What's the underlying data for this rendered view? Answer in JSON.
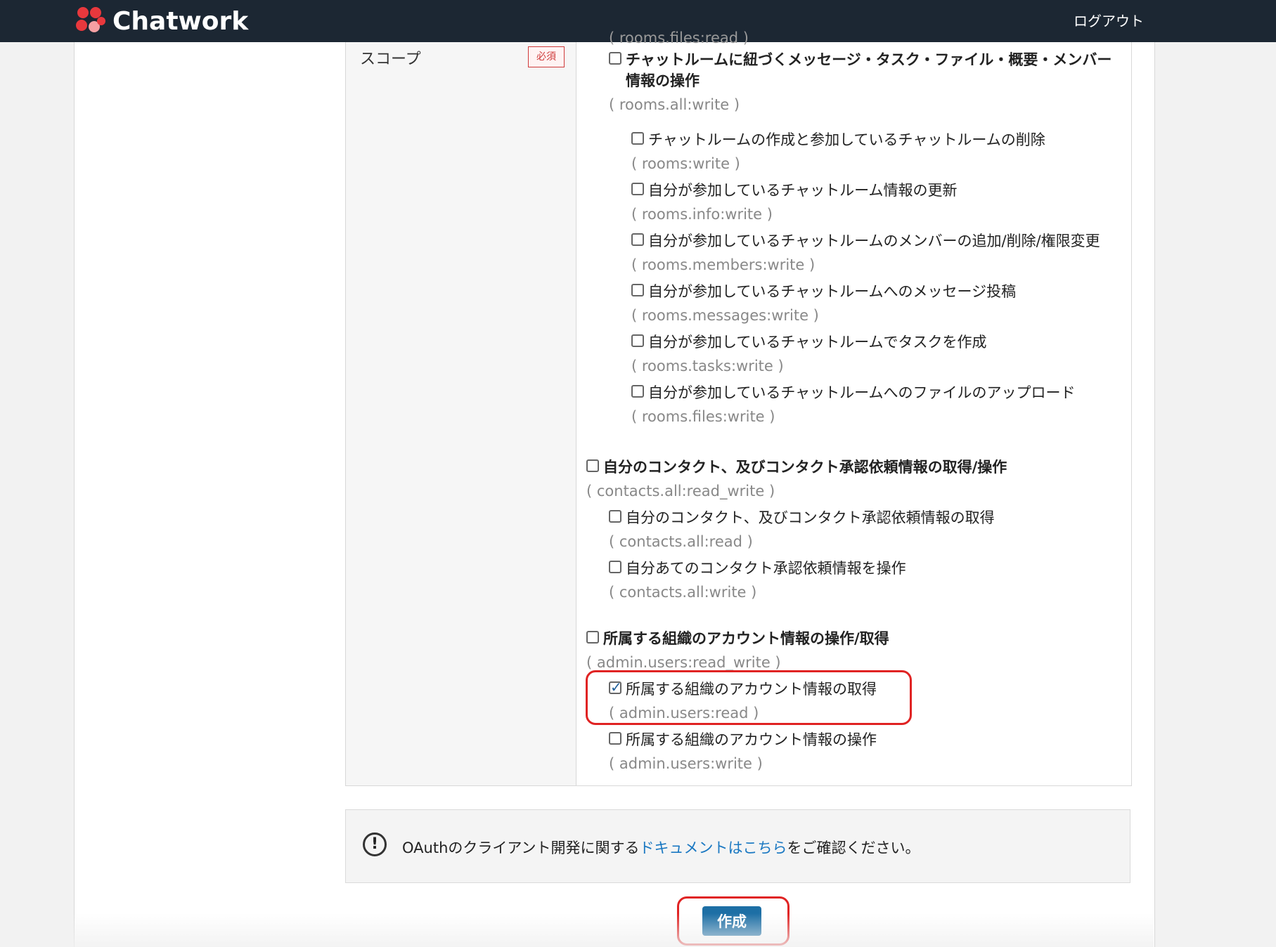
{
  "header": {
    "brand": "Chatwork",
    "logout_label": "ログアウト",
    "colors": {
      "background": "#1c2733",
      "logo_red": "#e8383d"
    }
  },
  "form": {
    "scope_label": "スコープ",
    "required_badge": "必須",
    "cut_off_text": "( rooms.files:read )",
    "groups": [
      {
        "label": "チャットルームに紐づくメッセージ・タスク・ファイル・概要・メンバー情報の操作",
        "code": "( rooms.all:write )",
        "checked": false,
        "items": [
          {
            "label": "チャットルームの作成と参加しているチャットルームの削除",
            "code": "( rooms:write )",
            "checked": false
          },
          {
            "label": "自分が参加しているチャットルーム情報の更新",
            "code": "( rooms.info:write )",
            "checked": false
          },
          {
            "label": "自分が参加しているチャットルームのメンバーの追加/削除/権限変更",
            "code": "( rooms.members:write )",
            "checked": false
          },
          {
            "label": "自分が参加しているチャットルームへのメッセージ投稿",
            "code": "( rooms.messages:write )",
            "checked": false
          },
          {
            "label": "自分が参加しているチャットルームでタスクを作成",
            "code": "( rooms.tasks:write )",
            "checked": false
          },
          {
            "label": "自分が参加しているチャットルームへのファイルのアップロード",
            "code": "( rooms.files:write )",
            "checked": false
          }
        ]
      },
      {
        "label": "自分のコンタクト、及びコンタクト承認依頼情報の取得/操作",
        "code": "( contacts.all:read_write )",
        "checked": false,
        "items": [
          {
            "label": "自分のコンタクト、及びコンタクト承認依頼情報の取得",
            "code": "( contacts.all:read )",
            "checked": false
          },
          {
            "label": "自分あてのコンタクト承認依頼情報を操作",
            "code": "( contacts.all:write )",
            "checked": false
          }
        ]
      },
      {
        "label": "所属する組織のアカウント情報の操作/取得",
        "code": "( admin.users:read_write )",
        "checked": false,
        "items": [
          {
            "label": "所属する組織のアカウント情報の取得",
            "code": "( admin.users:read )",
            "checked": true
          },
          {
            "label": "所属する組織のアカウント情報の操作",
            "code": "( admin.users:write )",
            "checked": false
          }
        ]
      }
    ]
  },
  "info": {
    "icon": "exclamation-circle-icon",
    "text_before": "OAuthのクライアント開発に関する",
    "link_text": "ドキュメントはこちら",
    "text_after": "をご確認ください。"
  },
  "actions": {
    "create_label": "作成",
    "button_color": "#1d6fa5",
    "highlight_color": "#e02323"
  }
}
